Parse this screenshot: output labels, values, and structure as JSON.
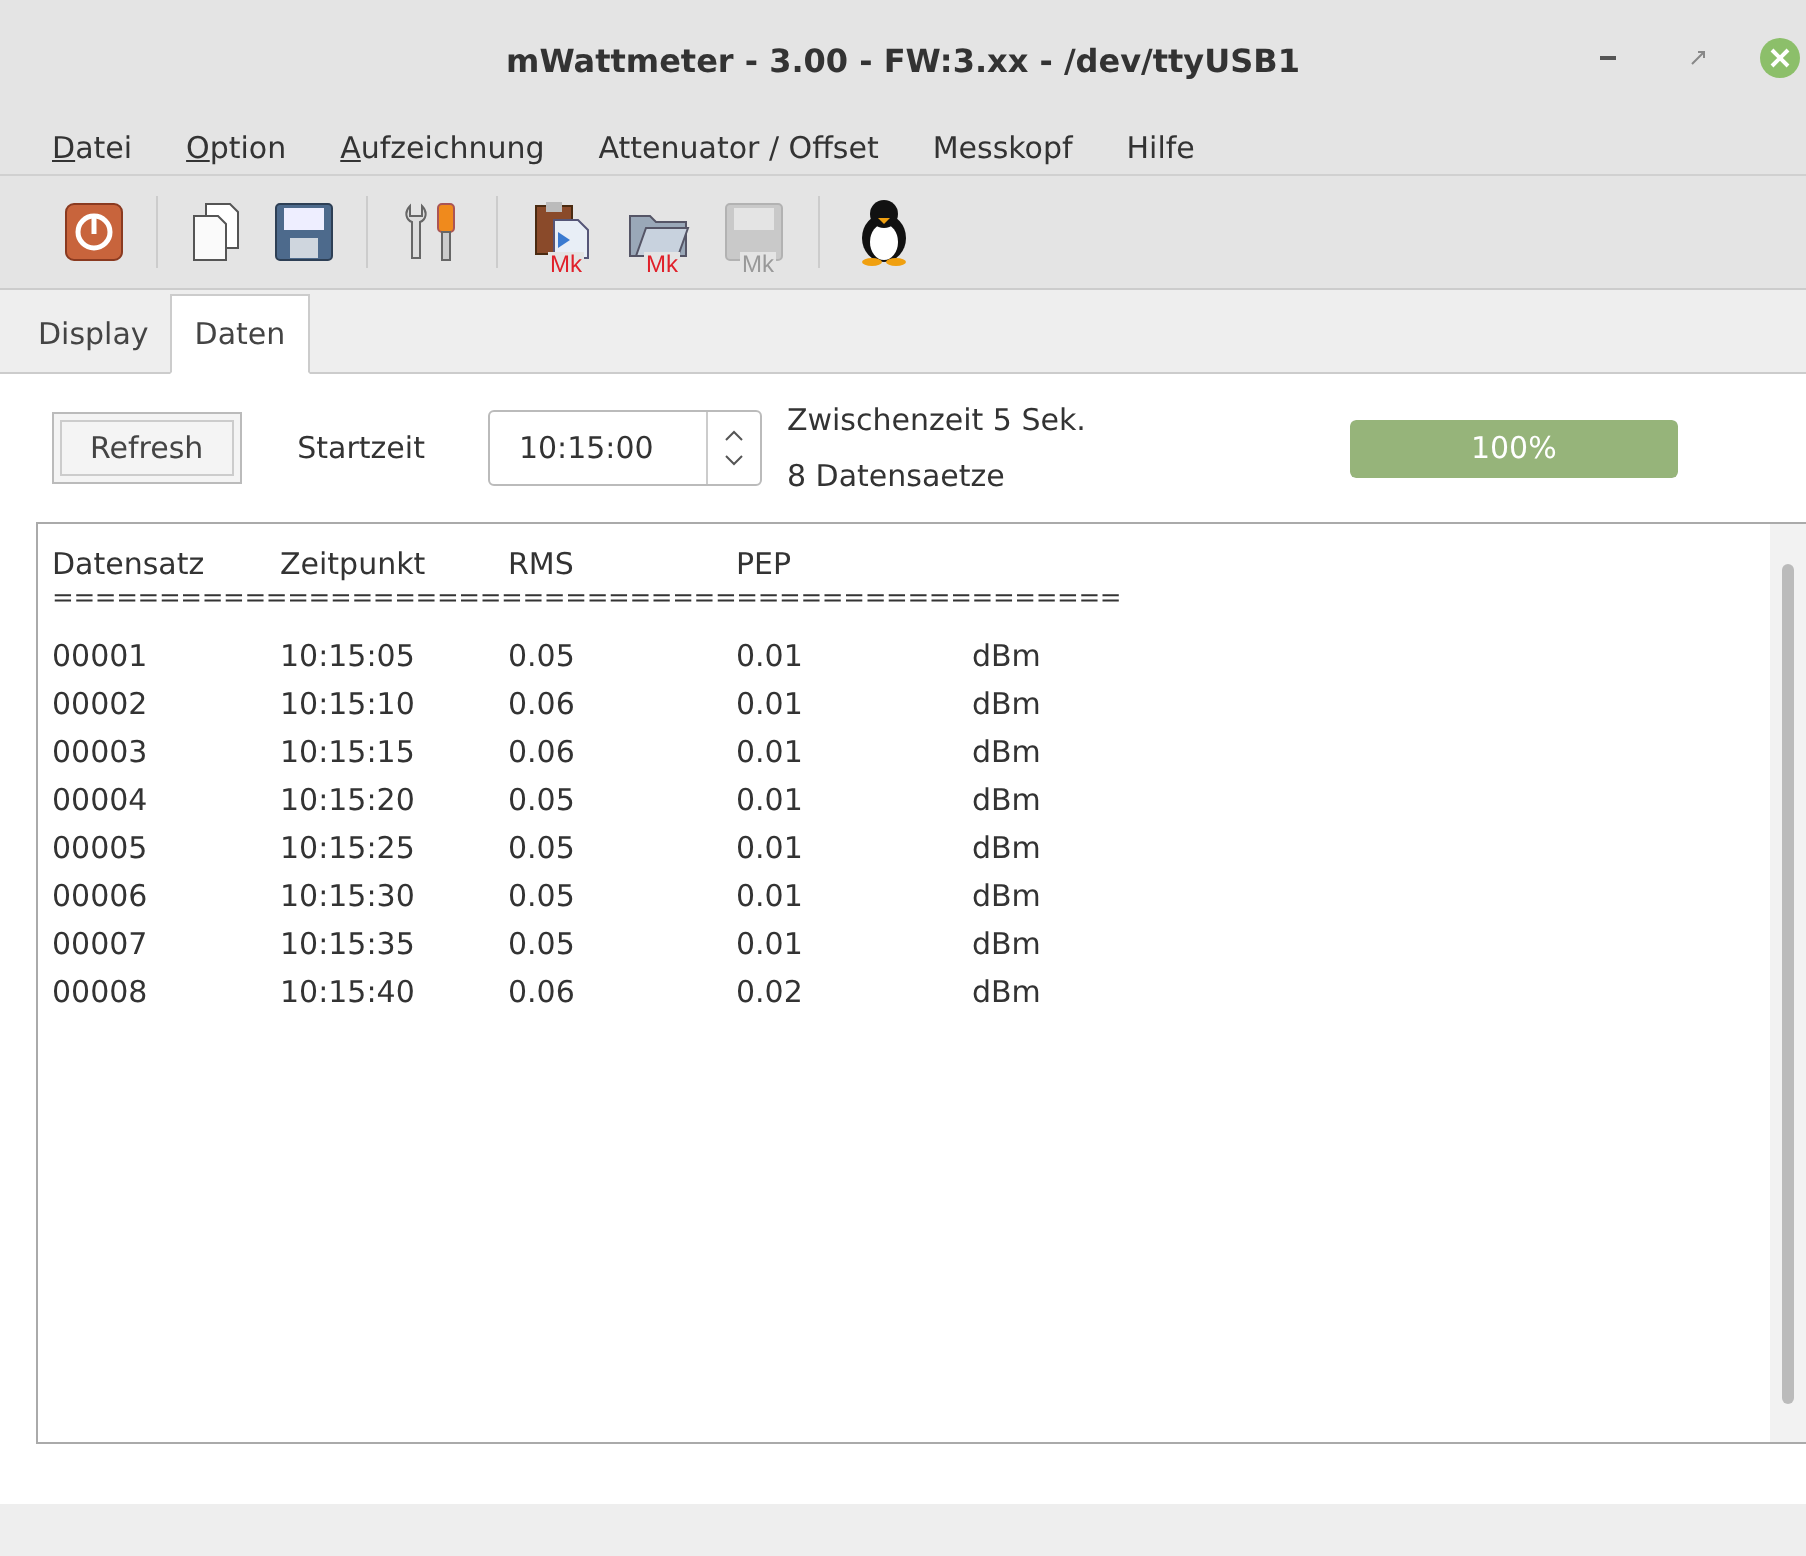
{
  "window": {
    "title": "mWattmeter - 3.00 - FW:3.xx - /dev/ttyUSB1"
  },
  "menu": [
    {
      "label": "Datei",
      "mnemonic": true
    },
    {
      "label": "Option",
      "mnemonic": true
    },
    {
      "label": "Aufzeichnung",
      "mnemonic": true
    },
    {
      "label": "Attenuator / Offset",
      "mnemonic": false
    },
    {
      "label": "Messkopf",
      "mnemonic": false
    },
    {
      "label": "Hilfe",
      "mnemonic": false
    }
  ],
  "toolbar": [
    {
      "kind": "power"
    },
    {
      "kind": "sep"
    },
    {
      "kind": "copy"
    },
    {
      "kind": "save"
    },
    {
      "kind": "sep"
    },
    {
      "kind": "tools"
    },
    {
      "kind": "sep"
    },
    {
      "kind": "clipboard",
      "badge": "Mk"
    },
    {
      "kind": "folder",
      "badge": "Mk"
    },
    {
      "kind": "floppy",
      "badge": "Mk",
      "disabled": true
    },
    {
      "kind": "sep"
    },
    {
      "kind": "penguin"
    }
  ],
  "tabs": [
    {
      "label": "Display",
      "selected": false
    },
    {
      "label": "Daten",
      "selected": true
    }
  ],
  "controls": {
    "refresh": "Refresh",
    "start_label": "Startzeit",
    "start_value": "10:15:00",
    "interval": "Zwischenzeit 5 Sek.",
    "count": "8 Datensaetze",
    "progress": {
      "level": 1.0,
      "reading": "100%"
    }
  },
  "text_area": {
    "header": [
      "Datensatz",
      "Zeitpunkt",
      "RMS",
      "PEP"
    ],
    "separator": "==================================================",
    "rows": [
      [
        "00001",
        "10:15:05",
        "0.05",
        "0.01",
        "dBm"
      ],
      [
        "00002",
        "10:15:10",
        "0.06",
        "0.01",
        "dBm"
      ],
      [
        "00003",
        "10:15:15",
        "0.06",
        "0.01",
        "dBm"
      ],
      [
        "00004",
        "10:15:20",
        "0.05",
        "0.01",
        "dBm"
      ],
      [
        "00005",
        "10:15:25",
        "0.05",
        "0.01",
        "dBm"
      ],
      [
        "00006",
        "10:15:30",
        "0.05",
        "0.01",
        "dBm"
      ],
      [
        "00007",
        "10:15:35",
        "0.05",
        "0.01",
        "dBm"
      ],
      [
        "00008",
        "10:15:40",
        "0.06",
        "0.02",
        "dBm"
      ]
    ]
  }
}
